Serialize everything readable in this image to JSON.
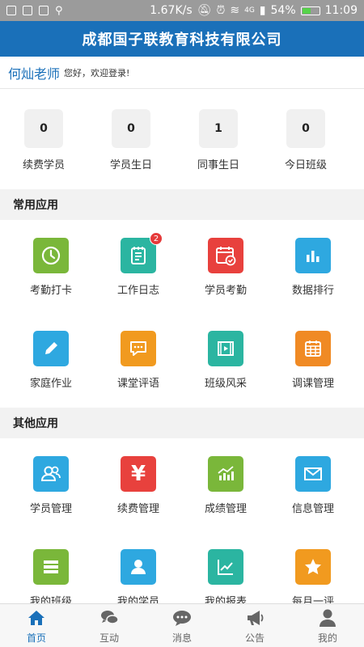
{
  "status_bar": {
    "net_speed": "1.67K/s",
    "signal": "4G",
    "battery": "54%",
    "battery_level": 0.54,
    "time": "11:09"
  },
  "header": {
    "title": "成都国子联教育科技有限公司"
  },
  "greeting": {
    "name": "何灿老师",
    "message": "您好，欢迎登录!"
  },
  "stats": [
    {
      "value": "0",
      "label": "续费学员"
    },
    {
      "value": "0",
      "label": "学员生日"
    },
    {
      "value": "1",
      "label": "同事生日"
    },
    {
      "value": "0",
      "label": "今日班级"
    }
  ],
  "common_apps": {
    "title": "常用应用",
    "items": [
      {
        "label": "考勤打卡",
        "icon": "clock-icon",
        "color": "#7ab73a"
      },
      {
        "label": "工作日志",
        "icon": "notebook-icon",
        "color": "#2bb5a1",
        "badge": "2"
      },
      {
        "label": "学员考勤",
        "icon": "calendar-check-icon",
        "color": "#e8413d"
      },
      {
        "label": "数据排行",
        "icon": "bar-chart-icon",
        "color": "#2ea8e0"
      },
      {
        "label": "家庭作业",
        "icon": "pencil-icon",
        "color": "#2ea8e0"
      },
      {
        "label": "课堂评语",
        "icon": "comment-icon",
        "color": "#f19a1f"
      },
      {
        "label": "班级风采",
        "icon": "video-icon",
        "color": "#2bb5a1"
      },
      {
        "label": "调课管理",
        "icon": "schedule-icon",
        "color": "#f08a24"
      }
    ]
  },
  "other_apps": {
    "title": "其他应用",
    "items": [
      {
        "label": "学员管理",
        "icon": "users-icon",
        "color": "#2ea8e0"
      },
      {
        "label": "续费管理",
        "icon": "yen-icon",
        "color": "#e8413d"
      },
      {
        "label": "成绩管理",
        "icon": "trend-chart-icon",
        "color": "#7ab73a"
      },
      {
        "label": "信息管理",
        "icon": "mail-icon",
        "color": "#2ea8e0"
      },
      {
        "label": "我的班级",
        "icon": "list-icon",
        "color": "#7ab73a"
      },
      {
        "label": "我的学员",
        "icon": "person-icon",
        "color": "#2ea8e0"
      },
      {
        "label": "我的报表",
        "icon": "line-chart-icon",
        "color": "#2bb5a1"
      },
      {
        "label": "每月一评",
        "icon": "star-icon",
        "color": "#f19a1f"
      }
    ]
  },
  "bottom_nav": [
    {
      "label": "首页",
      "icon": "home-icon",
      "active": true
    },
    {
      "label": "互动",
      "icon": "chat-icon",
      "active": false
    },
    {
      "label": "消息",
      "icon": "message-icon",
      "active": false
    },
    {
      "label": "公告",
      "icon": "megaphone-icon",
      "active": false
    },
    {
      "label": "我的",
      "icon": "profile-icon",
      "active": false
    }
  ],
  "colors": {
    "primary": "#1a70b9",
    "badge": "#e53a3a"
  }
}
